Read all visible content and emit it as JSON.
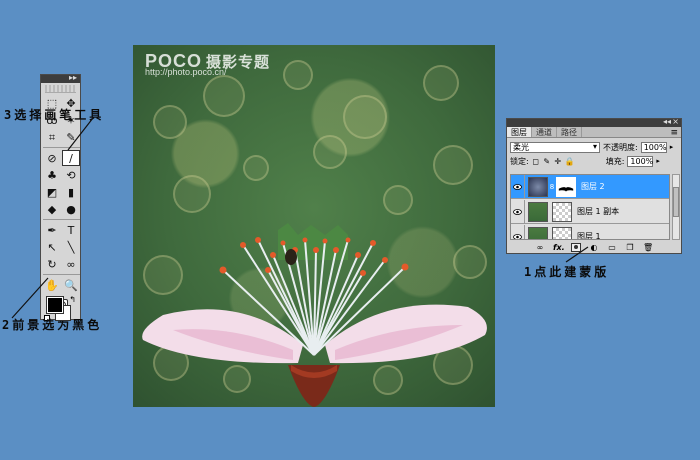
{
  "watermark": {
    "brand": "POCO",
    "title": "摄影专题",
    "url": "http://photo.poco.cn/"
  },
  "toolbox": {
    "tools": [
      {
        "icon": "marquee-icon",
        "glyph": "⬚"
      },
      {
        "icon": "move-icon",
        "glyph": "✥"
      },
      {
        "icon": "lasso-icon",
        "glyph": "ꝏ"
      },
      {
        "icon": "magic-wand-icon",
        "glyph": "✶"
      },
      {
        "icon": "crop-icon",
        "glyph": "⌗"
      },
      {
        "icon": "slice-icon",
        "glyph": "✎"
      },
      {
        "icon": "healing-brush-icon",
        "glyph": "⊘"
      },
      {
        "icon": "brush-icon",
        "glyph": "∕",
        "active": true
      },
      {
        "icon": "clone-stamp-icon",
        "glyph": "♣"
      },
      {
        "icon": "history-brush-icon",
        "glyph": "⟲"
      },
      {
        "icon": "eraser-icon",
        "glyph": "◩"
      },
      {
        "icon": "gradient-icon",
        "glyph": "▮"
      },
      {
        "icon": "blur-icon",
        "glyph": "◆"
      },
      {
        "icon": "dodge-icon",
        "glyph": "●"
      },
      {
        "icon": "pen-icon",
        "glyph": "✒"
      },
      {
        "icon": "type-icon",
        "glyph": "T"
      },
      {
        "icon": "path-select-icon",
        "glyph": "↖"
      },
      {
        "icon": "line-icon",
        "glyph": "╲"
      },
      {
        "icon": "3d-rotate-icon",
        "glyph": "↻"
      },
      {
        "icon": "3d-orbit-icon",
        "glyph": "∞"
      },
      {
        "icon": "hand-icon",
        "glyph": "✋"
      },
      {
        "icon": "zoom-icon",
        "glyph": "🔍"
      }
    ],
    "foreground_color": "#000000",
    "background_color": "#ffffff"
  },
  "layers_panel": {
    "tabs": [
      "图层",
      "通道",
      "路径"
    ],
    "active_tab": 0,
    "blend_mode": "柔光",
    "opacity_label": "不透明度:",
    "opacity_value": "100%",
    "lock_label": "锁定:",
    "fill_label": "填充:",
    "fill_value": "100%",
    "layers": [
      {
        "name": "图层 2",
        "selected": true,
        "has_mask": true
      },
      {
        "name": "图层 1 副本",
        "selected": false,
        "has_mask": false
      },
      {
        "name": "图层 1",
        "selected": false,
        "has_mask": false
      }
    ],
    "footer_icons": [
      "link-icon",
      "fx-icon",
      "add-mask-icon",
      "adjustment-icon",
      "group-icon",
      "new-layer-icon",
      "trash-icon"
    ]
  },
  "annotations": {
    "step1": "1点此建蒙版",
    "step2": "2前景选为黑色",
    "step3": "3选择画笔工具"
  },
  "colors": {
    "background": "#5b8fc4",
    "selection": "#3399ff"
  }
}
